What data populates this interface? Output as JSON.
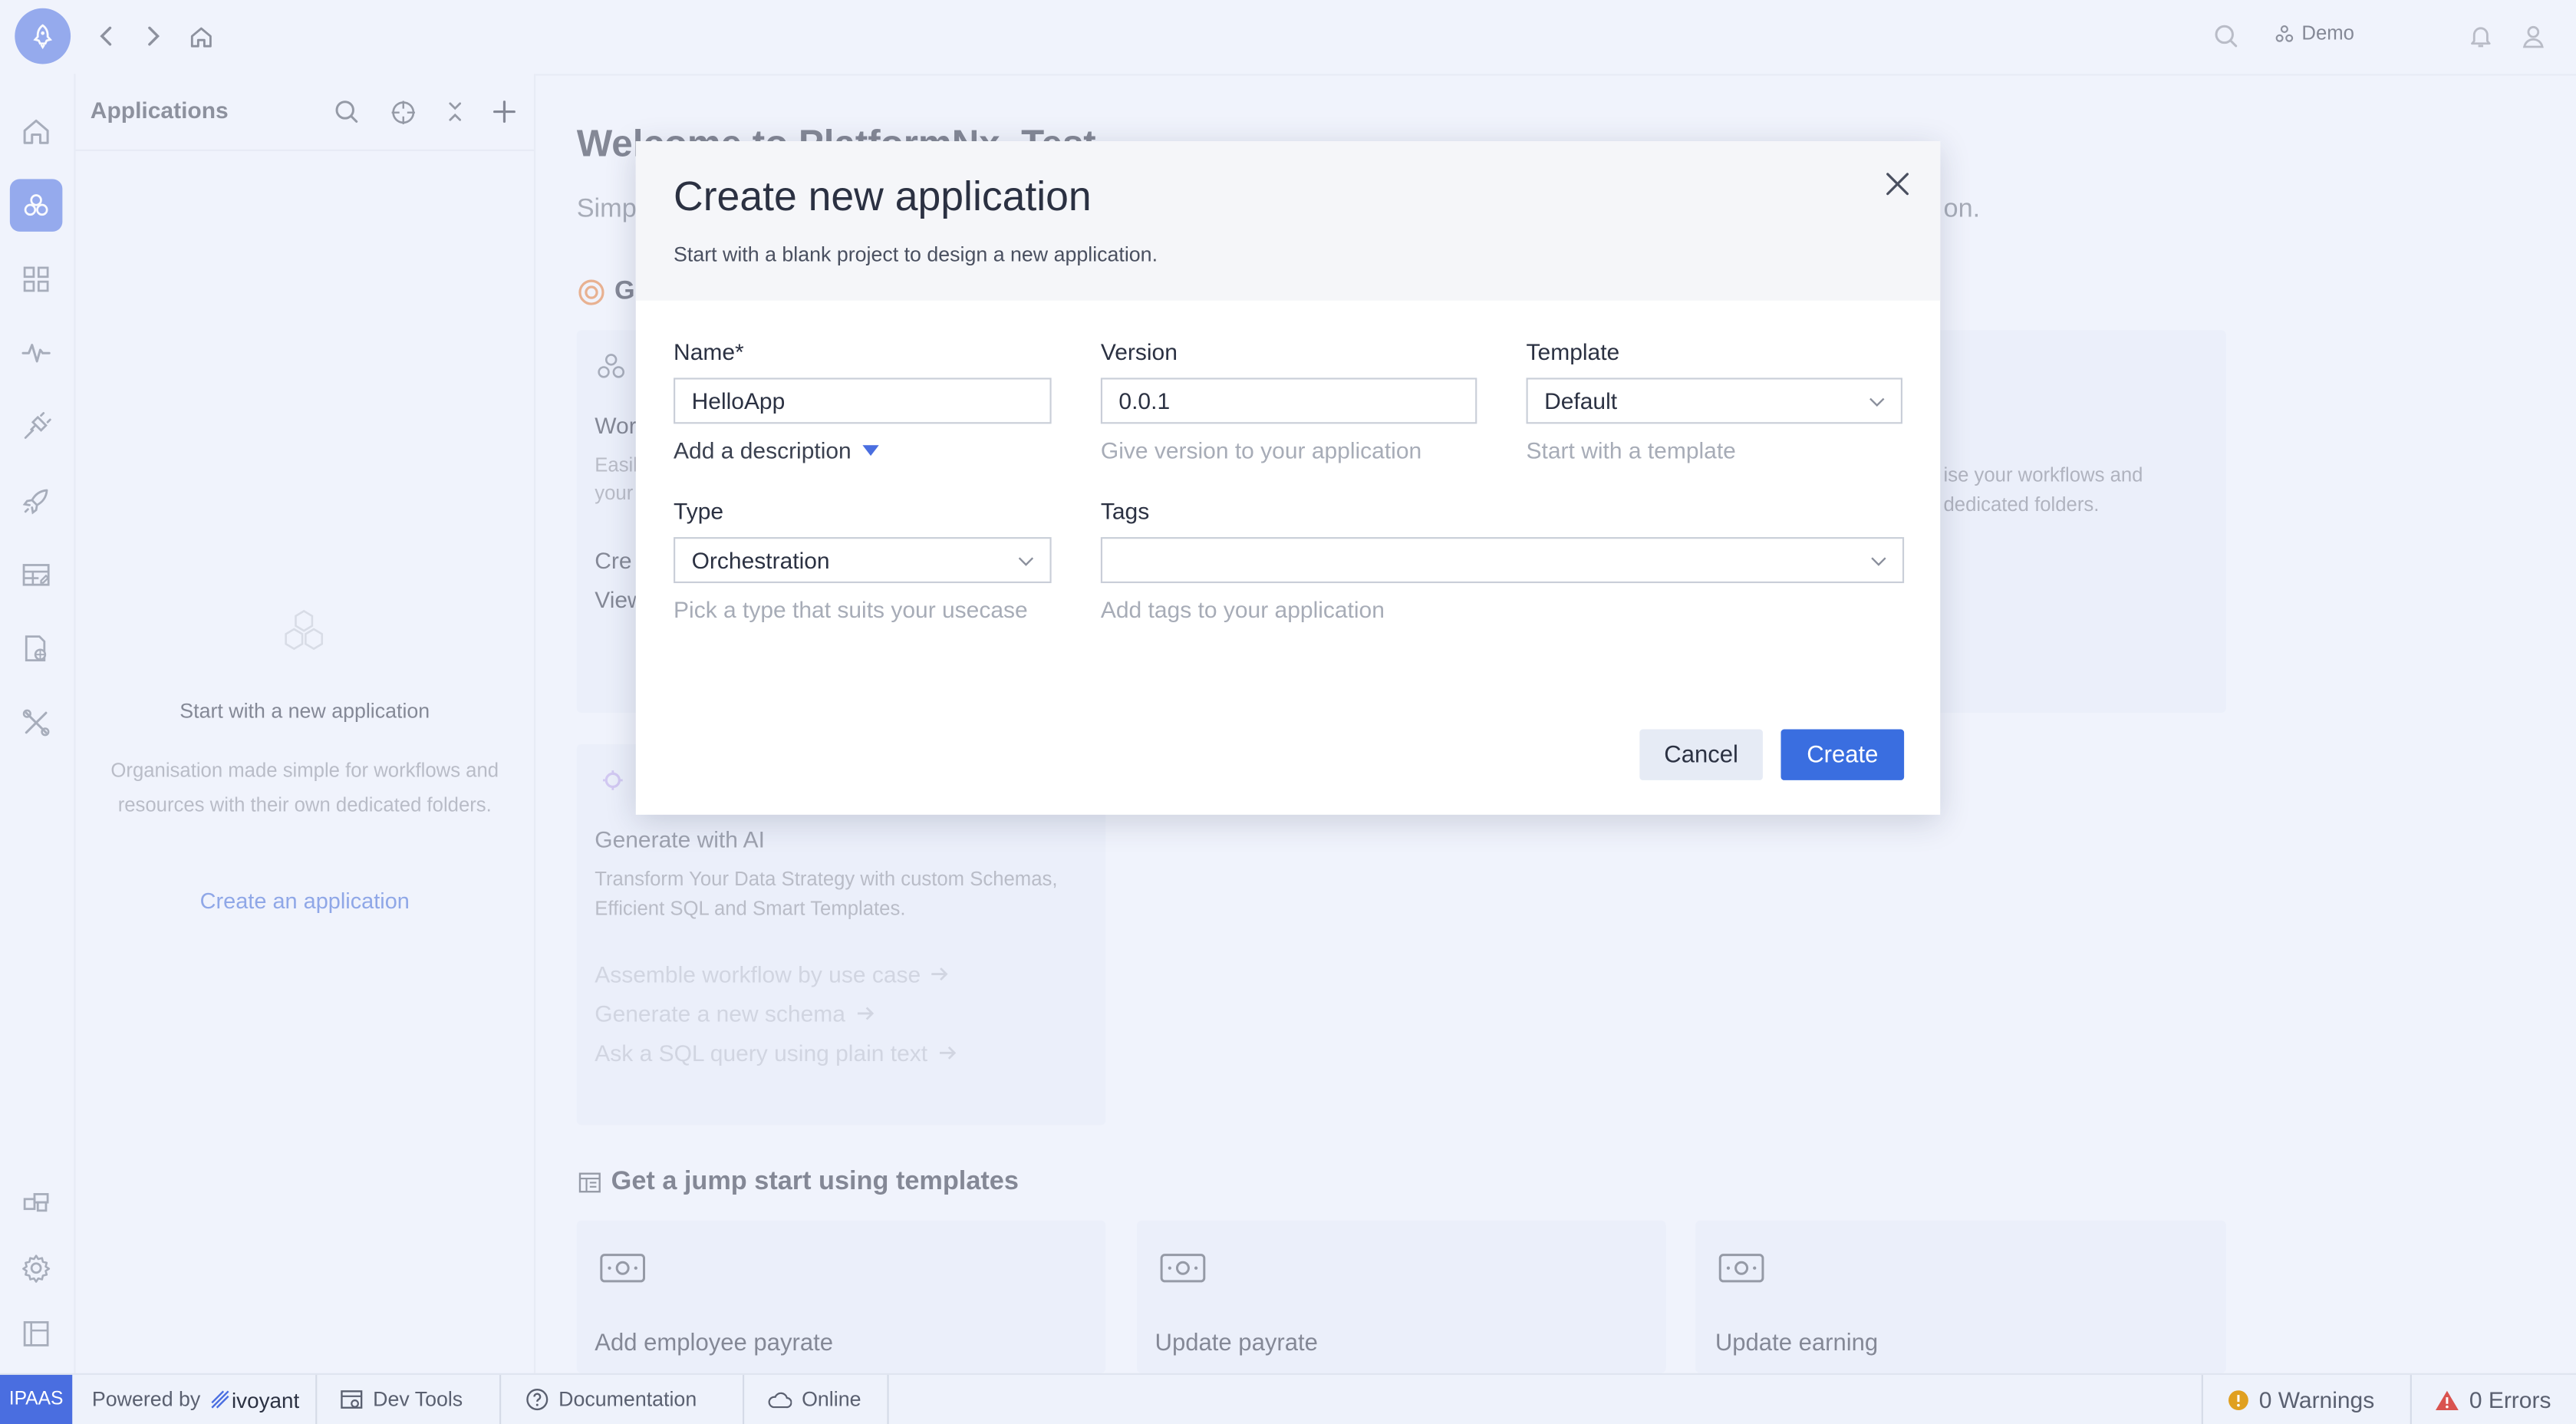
{
  "topbar": {
    "workspace": "Demo"
  },
  "panel": {
    "title": "Applications",
    "empty_title": "Start with a new application",
    "empty_desc": "Organisation made simple for workflows and resources with their own dedicated folders.",
    "empty_link": "Create an application"
  },
  "main": {
    "welcome": "Welcome to PlatformNx_Test",
    "subtitle": "Simp",
    "subtitle_tail": "on.",
    "section_get": "Ge",
    "card1": {
      "title": "Wor",
      "text1": "Easil",
      "text2": "your",
      "link1": "Cre",
      "link2": "View"
    },
    "card3": {
      "text1": "ise your workflows and",
      "text2": "dedicated folders."
    },
    "ai_card": {
      "title": "Generate with AI",
      "desc": "Transform Your Data Strategy with custom Schemas, Efficient SQL and Smart Templates.",
      "links": [
        "Assemble workflow by use case",
        "Generate a new schema",
        "Ask a SQL query using plain text"
      ]
    },
    "templates_heading": "Get a jump start using templates",
    "templates": [
      "Add employee payrate",
      "Update payrate",
      "Update earning"
    ]
  },
  "modal": {
    "title": "Create new application",
    "description": "Start with a blank project to design a new application.",
    "name_label": "Name*",
    "name_value": "HelloApp",
    "add_description": "Add a description",
    "version_label": "Version",
    "version_value": "0.0.1",
    "version_help": "Give version to your application",
    "template_label": "Template",
    "template_value": "Default",
    "template_help": "Start with a template",
    "type_label": "Type",
    "type_value": "Orchestration",
    "type_help": "Pick a type that suits your usecase",
    "tags_label": "Tags",
    "tags_help": "Add tags to your application",
    "cancel": "Cancel",
    "create": "Create"
  },
  "statusbar": {
    "badge": "IPAAS",
    "powered_by": "Powered by",
    "brand": "ivoyant",
    "dev_tools": "Dev Tools",
    "documentation": "Documentation",
    "online": "Online",
    "warnings": "0 Warnings",
    "errors": "0 Errors"
  },
  "colors": {
    "accent": "#4a6ee0",
    "create_button": "#3a6ee0",
    "link": "#3f68d6",
    "warning": "#e0a020",
    "error": "#d9534f"
  }
}
